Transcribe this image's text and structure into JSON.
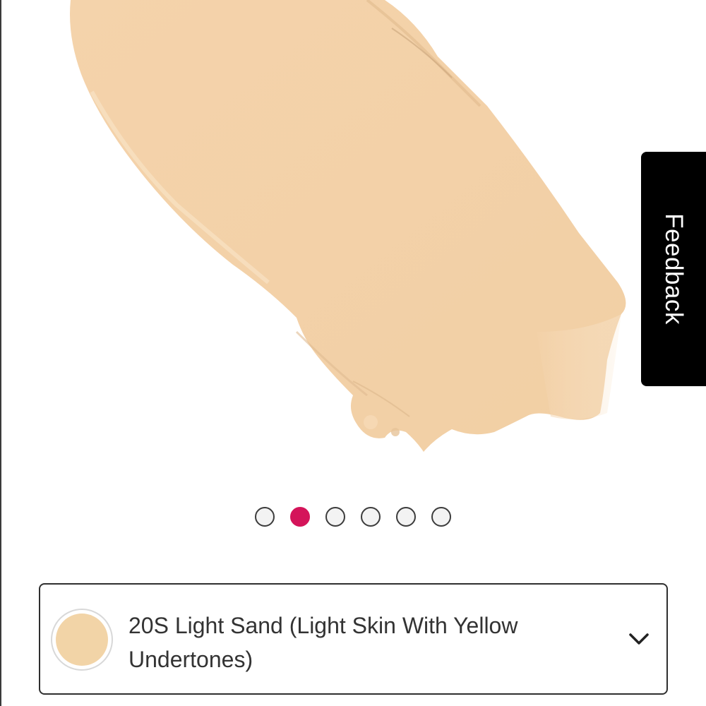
{
  "feedback": {
    "label": "Feedback",
    "background": "#000000",
    "text_color": "#ffffff"
  },
  "product_image": {
    "subject": "concealer swatch smear",
    "color": "#f3d3ac"
  },
  "carousel": {
    "slide_count": 6,
    "active_index": 1,
    "active_color": "#d4145a",
    "inactive_color": "#f3f3f3"
  },
  "shade_selector": {
    "label": "20S Light Sand (Light Skin With Yellow Undertones)",
    "swatch_color": "#f2d4a7",
    "icon": "chevron-down-icon"
  }
}
